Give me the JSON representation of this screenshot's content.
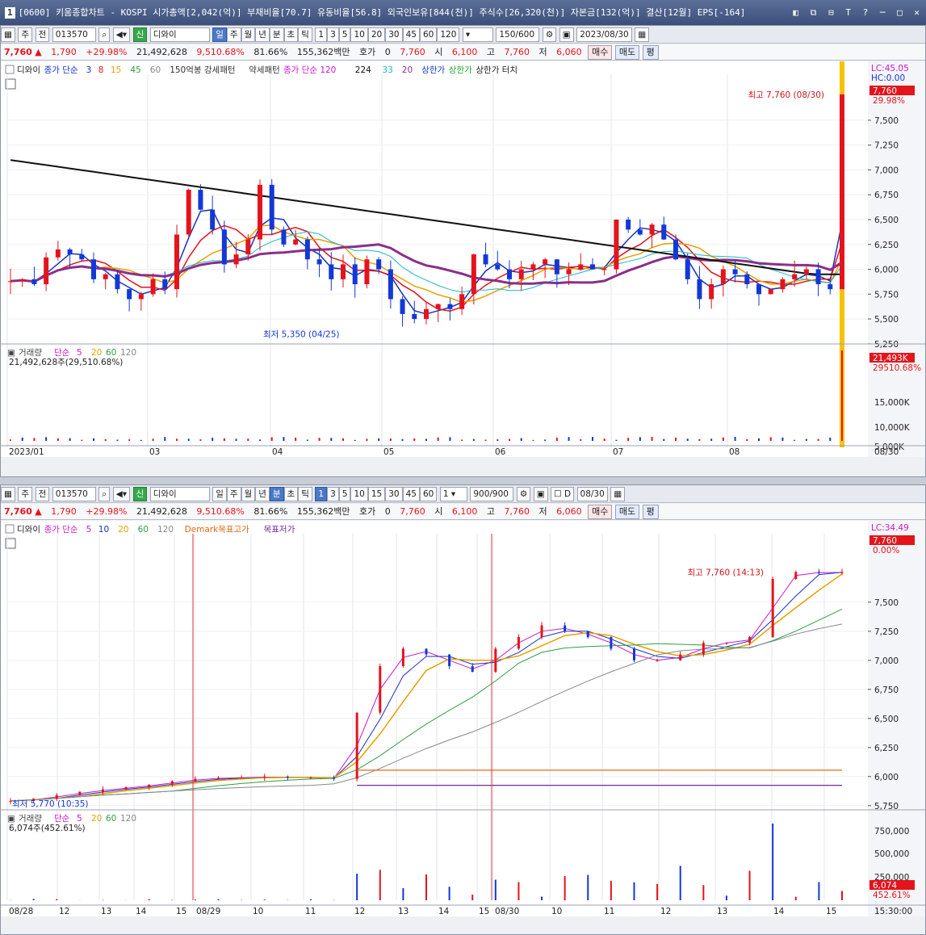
{
  "app": {
    "window_number": "1",
    "title": "[0600] 키움종합차트 - KOSPI 시가총액[2,042(억)] 부채비율[70.7] 유동비율[56.8] 외국인보유[844(천)] 주식수[26,320(천)] 자본금[132(억)] 결산[12월] EPS[-164]",
    "window_controls": "◧ ⧉ ⊟ T ? ─ □ ✕"
  },
  "stock": {
    "code": "013570",
    "name": "디와이",
    "market_badge": "신"
  },
  "quote": {
    "price": "7,760",
    "arrow": "▲",
    "change": "1,790",
    "change_pct": "+29.98%",
    "volume": "21,492,628",
    "vol_ratio": "9,510.68%",
    "turnover": "81.66%",
    "amount": "155,362백만",
    "hoga_label": "호가",
    "hoga_value": "0",
    "hoga_price": "7,760",
    "open_label": "시",
    "open": "6,100",
    "high_label": "고",
    "high": "7,760",
    "low_label": "저",
    "low": "6,060",
    "buy_label": "매수",
    "sell_label": "매도",
    "avg_label": "평"
  },
  "top_chart": {
    "toolbar": {
      "buttons": [
        "주",
        "전"
      ],
      "periods": [
        "일",
        "주",
        "월",
        "년",
        "분",
        "초",
        "틱"
      ],
      "selected_period": "일",
      "intervals": [
        "1",
        "3",
        "5",
        "10",
        "20",
        "30",
        "45",
        "60",
        "120"
      ],
      "count": "150/600",
      "date": "2023/08/30"
    },
    "legend": [
      {
        "text": "디와이",
        "color": "#222222"
      },
      {
        "text": "종가 단순",
        "color": "#1a33c0"
      },
      {
        "text": "3",
        "color": "#1a33c0"
      },
      {
        "text": "8",
        "color": "#e3141c"
      },
      {
        "text": "15",
        "color": "#e5a100"
      },
      {
        "text": "45",
        "color": "#2d9e47"
      },
      {
        "text": "60",
        "color": "#888888"
      },
      {
        "text": "150억봉 강세패턴",
        "color": "#333333"
      },
      {
        "text": "약세패턴",
        "color": "#333333"
      },
      {
        "text": "종가 단순 120",
        "color": "#cc18c8"
      },
      {
        "text": "224",
        "color": "#111111"
      },
      {
        "text": "33",
        "color": "#18b7c9"
      },
      {
        "text": "20",
        "color": "#8a2f8a"
      },
      {
        "text": "상한가",
        "color": "#1238d6"
      },
      {
        "text": "상한가",
        "color": "#25a331"
      },
      {
        "text": "상한가 터치",
        "color": "#222222"
      }
    ],
    "y_ticks": [
      "7,500",
      "7,250",
      "7,000",
      "6,750",
      "6,500",
      "6,250",
      "6,000",
      "5,750",
      "5,500",
      "5,250"
    ],
    "right_labels": {
      "lc": "LC:45.05",
      "hc": "HC:0.00",
      "price": "7,760",
      "pct": "29.98%"
    },
    "annotations": {
      "high": "최고 7,760 (08/30)",
      "low": "최저 5,350 (04/25)"
    },
    "volume": {
      "title": "거래량",
      "ma_label": "단순",
      "ma": [
        "5",
        "20",
        "60",
        "120"
      ],
      "value_text": "21,492,628주(29,510.68%)",
      "last": "21,493K",
      "last_pct": "29510.68%",
      "y_ticks": [
        "15,000K",
        "10,000K",
        "5,000K"
      ]
    },
    "x_ticks": [
      "2023/01",
      "03",
      "04",
      "05",
      "06",
      "07",
      "08"
    ],
    "x_last": "08/30",
    "chart_data": {
      "type": "candlestick",
      "period": "daily",
      "ylim": [
        5200,
        7800
      ],
      "series_close": [
        5880,
        5900,
        5850,
        6120,
        6200,
        6150,
        6100,
        5900,
        5950,
        5800,
        5700,
        5750,
        5900,
        5800,
        6350,
        6800,
        6600,
        6400,
        6050,
        6150,
        6300,
        6850,
        6400,
        6250,
        6300,
        6100,
        6050,
        5900,
        6050,
        5850,
        6100,
        6000,
        5700,
        5550,
        5500,
        5600,
        5650,
        5600,
        5750,
        6150,
        6050,
        6000,
        5900,
        6000,
        6050,
        6100,
        5950,
        6000,
        6050,
        6000,
        6000,
        6500,
        6400,
        6350,
        6450,
        6300,
        6100,
        5900,
        5700,
        5850,
        6000,
        5950,
        5850,
        5750,
        5800,
        5900,
        5950,
        6000,
        5850,
        5800,
        7760
      ],
      "high": {
        "value": 7760,
        "date": "08/30"
      },
      "low": {
        "value": 5350,
        "date": "04/25"
      }
    }
  },
  "bottom_chart": {
    "toolbar": {
      "buttons": [
        "주",
        "전"
      ],
      "periods": [
        "일",
        "주",
        "월",
        "년",
        "분",
        "초",
        "틱"
      ],
      "selected_period": "분",
      "intervals": [
        "1",
        "3",
        "5",
        "10",
        "15",
        "30",
        "45",
        "60"
      ],
      "selected_interval": "1",
      "step": "1",
      "count": "900/900",
      "date_checkbox": "D",
      "date": "08/30"
    },
    "legend": [
      {
        "text": "디와이",
        "color": "#222222"
      },
      {
        "text": "종가 단순",
        "color": "#cc18c8"
      },
      {
        "text": "5",
        "color": "#cc18c8"
      },
      {
        "text": "10",
        "color": "#1a33c0"
      },
      {
        "text": "20",
        "color": "#e5a100"
      },
      {
        "text": "60",
        "color": "#2d9e47"
      },
      {
        "text": "120",
        "color": "#888888"
      },
      {
        "text": "Demark목표고가",
        "color": "#e06a12"
      },
      {
        "text": "목표저가",
        "color": "#6d2a9c"
      }
    ],
    "y_ticks": [
      "7,500",
      "7,250",
      "7,000",
      "6,750",
      "6,500",
      "6,250",
      "6,000",
      "5,750"
    ],
    "right_labels": {
      "lc": "LC:34.49",
      "price": "7,760",
      "pct": "0.00%"
    },
    "annotations": {
      "high": "최고 7,760 (14:13)",
      "low": "최저 5,770 (10:35)"
    },
    "volume": {
      "title": "거래량",
      "ma_label": "단순",
      "ma": [
        "5",
        "20",
        "60",
        "120"
      ],
      "value_text": "6,074주(452.61%)",
      "last": "6,074",
      "last_pct": "452.61%",
      "y_ticks": [
        "750,000",
        "500,000",
        "250,000"
      ]
    },
    "x_ticks": [
      "08/28",
      "12",
      "13",
      "14",
      "15",
      "08/29",
      "10",
      "11",
      "12",
      "13",
      "14",
      "15",
      "08/30",
      "10",
      "11",
      "12",
      "13",
      "14",
      "15"
    ],
    "x_last": "15:30:00",
    "chart_data": {
      "type": "candlestick",
      "period": "1-minute",
      "ylim": [
        5700,
        7950
      ],
      "demark_target_high": 6055,
      "demark_target_low": 5925,
      "series_close": [
        5790,
        5810,
        5840,
        5870,
        5890,
        5910,
        5930,
        5960,
        5980,
        5990,
        5990,
        6000,
        5990,
        5990,
        5980,
        6550,
        6950,
        7100,
        7050,
        6950,
        6900,
        7100,
        7200,
        7300,
        7250,
        7200,
        7100,
        7000,
        7000,
        7050,
        7150,
        7150,
        7200,
        7700,
        7760,
        7750,
        7760
      ],
      "high": {
        "value": 7760,
        "time": "14:13"
      },
      "low": {
        "value": 5770,
        "time": "10:35"
      }
    }
  }
}
